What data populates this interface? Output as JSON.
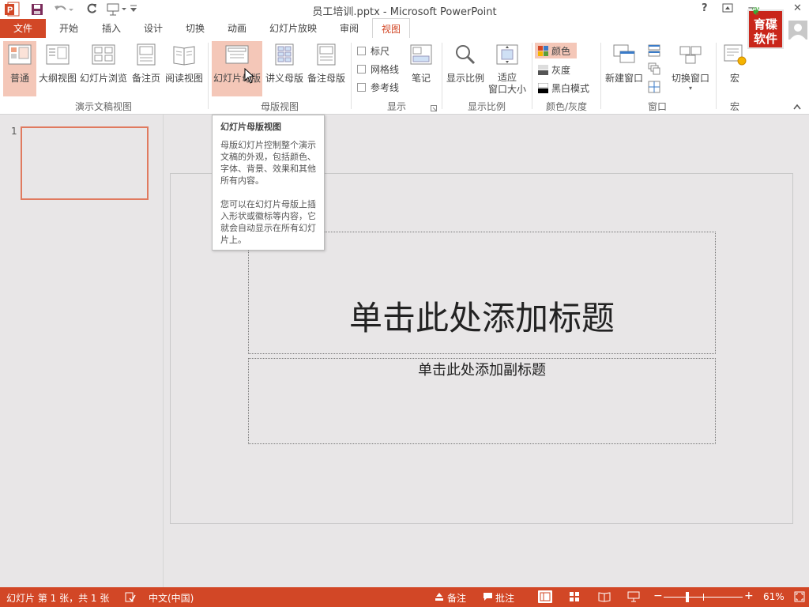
{
  "window": {
    "title": "员工培训.pptx - Microsoft PowerPoint",
    "help_label": "?",
    "minimize_label": "−",
    "close_label": "✕"
  },
  "brand_colors": {
    "accent": "#d24726",
    "tab_text": "#444444",
    "selected_bg": "#f4c7b8"
  },
  "tabs": [
    {
      "label": "文件"
    },
    {
      "label": "开始"
    },
    {
      "label": "插入"
    },
    {
      "label": "设计"
    },
    {
      "label": "切换"
    },
    {
      "label": "动画"
    },
    {
      "label": "幻灯片放映"
    },
    {
      "label": "审阅"
    },
    {
      "label": "视图"
    }
  ],
  "ribbon": {
    "groups": {
      "presentation_views": "演示文稿视图",
      "master_views": "母版视图",
      "show": "显示",
      "zoom": "显示比例",
      "color": "颜色/灰度",
      "window": "窗口",
      "macros": "宏"
    },
    "buttons": {
      "normal": "普通",
      "outline": "大纲视图",
      "slide_sorter": "幻灯片浏览",
      "notes_page": "备注页",
      "reading": "阅读视图",
      "slide_master": "幻灯片母版",
      "handout_master": "讲义母版",
      "notes_master": "备注母版",
      "notes": "笔记",
      "zoom": "显示比例",
      "fit_window_1": "适应",
      "fit_window_2": "窗口大小",
      "new_window": "新建窗口",
      "switch_window": "切换窗口",
      "macros": "宏"
    },
    "checkboxes": {
      "ruler": "标尺",
      "gridlines": "网格线",
      "guides": "参考线"
    },
    "color_modes": {
      "color": "颜色",
      "grayscale": "灰度",
      "bw": "黑白模式"
    },
    "watermark_lines": [
      "育碟",
      "软件"
    ]
  },
  "tooltip": {
    "title": "幻灯片母版视图",
    "desc1": "母版幻灯片控制整个演示文稿的外观，包括颜色、字体、背景、效果和其他所有内容。",
    "desc2": "您可以在幻灯片母版上插入形状或徽标等内容，它就会自动显示在所有幻灯片上。"
  },
  "thumbnails": {
    "number": "1"
  },
  "slide": {
    "title_placeholder": "单击此处添加标题",
    "subtitle_placeholder": "单击此处添加副标题"
  },
  "status": {
    "slide_info": "幻灯片 第 1 张，共 1 张",
    "language": "中文(中国)",
    "notes": "备注",
    "comments": "批注",
    "zoom_minus": "−",
    "zoom_plus": "+",
    "zoom": "61%",
    "zoom_fraction": 0.61
  }
}
